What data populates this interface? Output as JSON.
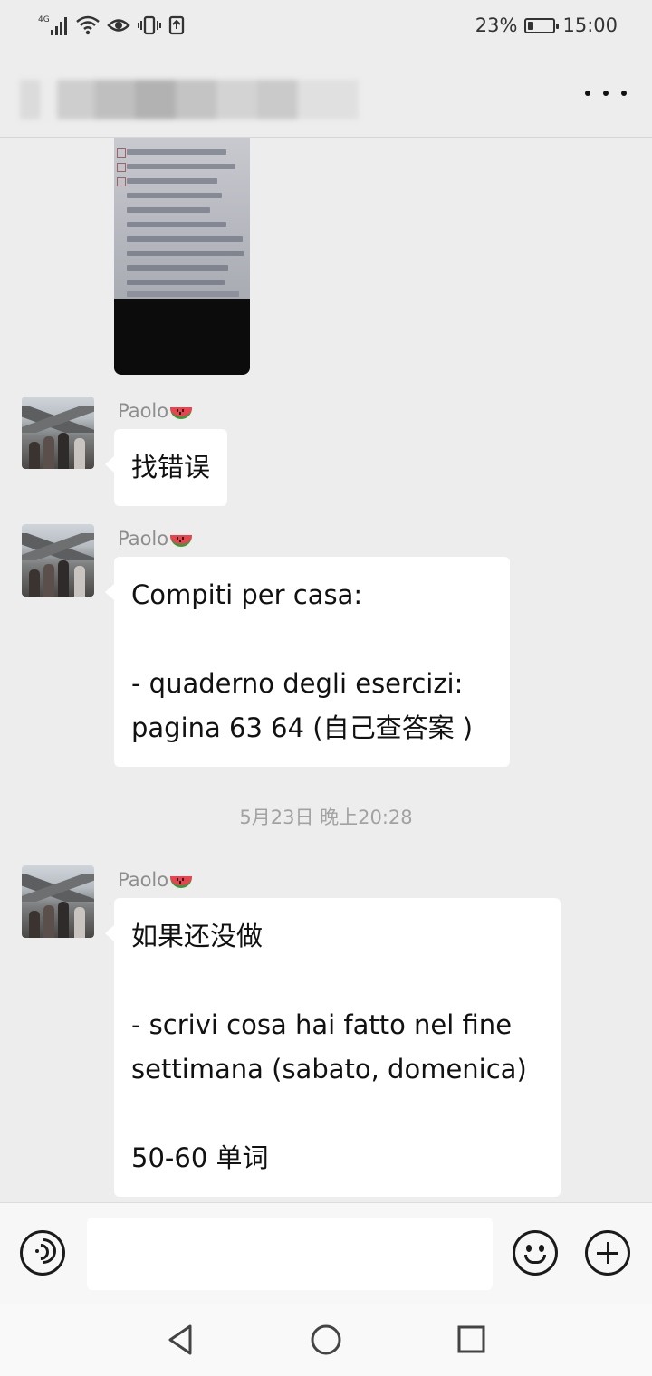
{
  "status_bar": {
    "network": "4G",
    "battery_percent": "23%",
    "battery_level": 0.23,
    "time": "15:00"
  },
  "header": {
    "title_blurred": true,
    "more_icon": "more-dots-icon"
  },
  "messages": [
    {
      "type": "image",
      "description_icon": "photo-thumbnail"
    },
    {
      "type": "text",
      "sender": "Paolo",
      "text": "找错误"
    },
    {
      "type": "text",
      "sender": "Paolo",
      "text": "Compiti per casa:\n\n- quaderno degli esercizi: pagina 63 64 (自己查答案 )"
    },
    {
      "type": "timestamp",
      "text": "5月23日 晚上20:28"
    },
    {
      "type": "text",
      "sender": "Paolo",
      "text": "如果还没做\n\n- scrivi cosa hai fatto nel fine settimana (sabato, domenica)\n\n50-60 单词"
    }
  ],
  "input_bar": {
    "voice_icon": "voice-icon",
    "input_value": "",
    "emoji_icon": "emoji-icon",
    "plus_icon": "plus-icon"
  },
  "nav_bar": {
    "back_icon": "back-triangle-icon",
    "home_icon": "home-circle-icon",
    "recent_icon": "recent-square-icon"
  },
  "colors": {
    "background": "#ededed",
    "bubble": "#ffffff",
    "sender_name": "#8e8e8e",
    "timestamp": "#a2a2a2"
  }
}
